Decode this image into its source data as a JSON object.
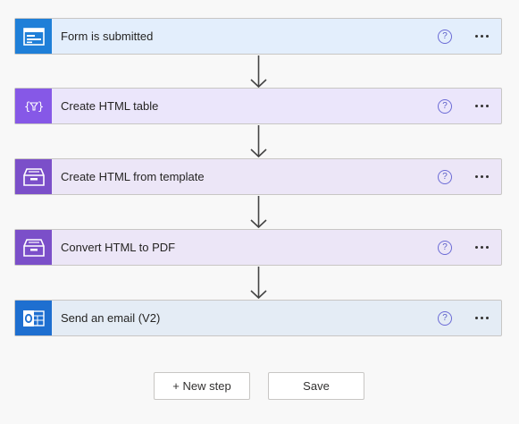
{
  "colors": {
    "forms_accent": "#1f7fd8",
    "forms_bg": "#e3eefc",
    "html_table_accent": "#8658e7",
    "html_table_bg": "#ebe6fb",
    "html_template_accent": "#7b4fc9",
    "html_template_bg": "#ece6f7",
    "outlook_accent": "#1e6fd0",
    "outlook_bg": "#e4ecf5"
  },
  "steps": [
    {
      "title": "Form is submitted",
      "icon": "forms-icon",
      "help": "?",
      "more": "..."
    },
    {
      "title": "Create HTML table",
      "icon": "html-table-icon",
      "help": "?",
      "more": "..."
    },
    {
      "title": "Create HTML from template",
      "icon": "archive-box-icon",
      "help": "?",
      "more": "..."
    },
    {
      "title": "Convert HTML to PDF",
      "icon": "archive-box-icon",
      "help": "?",
      "more": "..."
    },
    {
      "title": "Send an email (V2)",
      "icon": "outlook-icon",
      "help": "?",
      "more": "..."
    }
  ],
  "actions": {
    "new_step_label": "+ New step",
    "save_label": "Save"
  }
}
